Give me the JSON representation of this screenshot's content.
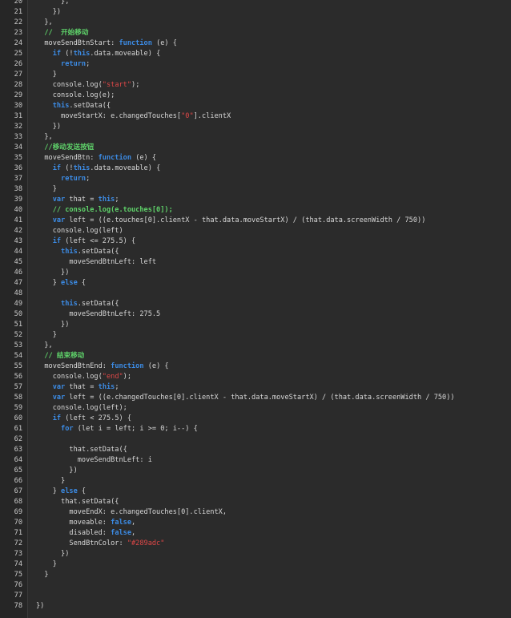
{
  "editor": {
    "lines": [
      {
        "n": "20",
        "tokens": [
          {
            "t": "      },",
            "c": "plain"
          }
        ]
      },
      {
        "n": "21",
        "tokens": [
          {
            "t": "    })",
            "c": "plain"
          }
        ]
      },
      {
        "n": "22",
        "tokens": [
          {
            "t": "  },",
            "c": "plain"
          }
        ]
      },
      {
        "n": "23",
        "tokens": [
          {
            "t": "  ",
            "c": "plain"
          },
          {
            "t": "//  开始移动",
            "c": "com"
          }
        ]
      },
      {
        "n": "24",
        "tokens": [
          {
            "t": "  moveSendBtnStart: ",
            "c": "plain"
          },
          {
            "t": "function",
            "c": "kw"
          },
          {
            "t": " (e) {",
            "c": "plain"
          }
        ]
      },
      {
        "n": "25",
        "tokens": [
          {
            "t": "    ",
            "c": "plain"
          },
          {
            "t": "if",
            "c": "kw"
          },
          {
            "t": " (!",
            "c": "plain"
          },
          {
            "t": "this",
            "c": "kw"
          },
          {
            "t": ".data.moveable) {",
            "c": "plain"
          }
        ]
      },
      {
        "n": "26",
        "tokens": [
          {
            "t": "      ",
            "c": "plain"
          },
          {
            "t": "return",
            "c": "kw"
          },
          {
            "t": ";",
            "c": "plain"
          }
        ]
      },
      {
        "n": "27",
        "tokens": [
          {
            "t": "    }",
            "c": "plain"
          }
        ]
      },
      {
        "n": "28",
        "tokens": [
          {
            "t": "    console.log(",
            "c": "plain"
          },
          {
            "t": "\"start\"",
            "c": "str"
          },
          {
            "t": ");",
            "c": "plain"
          }
        ]
      },
      {
        "n": "29",
        "tokens": [
          {
            "t": "    console.log(e);",
            "c": "plain"
          }
        ]
      },
      {
        "n": "30",
        "tokens": [
          {
            "t": "    ",
            "c": "plain"
          },
          {
            "t": "this",
            "c": "kw"
          },
          {
            "t": ".setData({",
            "c": "plain"
          }
        ]
      },
      {
        "n": "31",
        "tokens": [
          {
            "t": "      moveStartX: e.changedTouches[",
            "c": "plain"
          },
          {
            "t": "\"0\"",
            "c": "str"
          },
          {
            "t": "].clientX",
            "c": "plain"
          }
        ]
      },
      {
        "n": "32",
        "tokens": [
          {
            "t": "    })",
            "c": "plain"
          }
        ]
      },
      {
        "n": "33",
        "tokens": [
          {
            "t": "  },",
            "c": "plain"
          }
        ]
      },
      {
        "n": "34",
        "tokens": [
          {
            "t": "  ",
            "c": "plain"
          },
          {
            "t": "//移动发送按钮",
            "c": "com"
          }
        ]
      },
      {
        "n": "35",
        "tokens": [
          {
            "t": "  moveSendBtn: ",
            "c": "plain"
          },
          {
            "t": "function",
            "c": "kw"
          },
          {
            "t": " (e) {",
            "c": "plain"
          }
        ]
      },
      {
        "n": "36",
        "tokens": [
          {
            "t": "    ",
            "c": "plain"
          },
          {
            "t": "if",
            "c": "kw"
          },
          {
            "t": " (!",
            "c": "plain"
          },
          {
            "t": "this",
            "c": "kw"
          },
          {
            "t": ".data.moveable) {",
            "c": "plain"
          }
        ]
      },
      {
        "n": "37",
        "tokens": [
          {
            "t": "      ",
            "c": "plain"
          },
          {
            "t": "return",
            "c": "kw"
          },
          {
            "t": ";",
            "c": "plain"
          }
        ]
      },
      {
        "n": "38",
        "tokens": [
          {
            "t": "    }",
            "c": "plain"
          }
        ]
      },
      {
        "n": "39",
        "tokens": [
          {
            "t": "    ",
            "c": "plain"
          },
          {
            "t": "var",
            "c": "kw"
          },
          {
            "t": " that = ",
            "c": "plain"
          },
          {
            "t": "this",
            "c": "kw"
          },
          {
            "t": ";",
            "c": "plain"
          }
        ]
      },
      {
        "n": "40",
        "tokens": [
          {
            "t": "    ",
            "c": "plain"
          },
          {
            "t": "// console.log(e.touches[0]);",
            "c": "com"
          }
        ]
      },
      {
        "n": "41",
        "tokens": [
          {
            "t": "    ",
            "c": "plain"
          },
          {
            "t": "var",
            "c": "kw"
          },
          {
            "t": " left = ((e.touches[0].clientX - that.data.moveStartX) / (that.data.screenWidth / 750))",
            "c": "plain"
          }
        ]
      },
      {
        "n": "42",
        "tokens": [
          {
            "t": "    console.log(left)",
            "c": "plain"
          }
        ]
      },
      {
        "n": "43",
        "tokens": [
          {
            "t": "    ",
            "c": "plain"
          },
          {
            "t": "if",
            "c": "kw"
          },
          {
            "t": " (left <= 275.5) {",
            "c": "plain"
          }
        ]
      },
      {
        "n": "44",
        "tokens": [
          {
            "t": "      ",
            "c": "plain"
          },
          {
            "t": "this",
            "c": "kw"
          },
          {
            "t": ".setData({",
            "c": "plain"
          }
        ]
      },
      {
        "n": "45",
        "tokens": [
          {
            "t": "        moveSendBtnLeft: left",
            "c": "plain"
          }
        ]
      },
      {
        "n": "46",
        "tokens": [
          {
            "t": "      })",
            "c": "plain"
          }
        ]
      },
      {
        "n": "47",
        "tokens": [
          {
            "t": "    } ",
            "c": "plain"
          },
          {
            "t": "else",
            "c": "kw"
          },
          {
            "t": " {",
            "c": "plain"
          }
        ]
      },
      {
        "n": "48",
        "tokens": [
          {
            "t": "",
            "c": "plain"
          }
        ]
      },
      {
        "n": "49",
        "tokens": [
          {
            "t": "      ",
            "c": "plain"
          },
          {
            "t": "this",
            "c": "kw"
          },
          {
            "t": ".setData({",
            "c": "plain"
          }
        ]
      },
      {
        "n": "50",
        "tokens": [
          {
            "t": "        moveSendBtnLeft: 275.5",
            "c": "plain"
          }
        ]
      },
      {
        "n": "51",
        "tokens": [
          {
            "t": "      })",
            "c": "plain"
          }
        ]
      },
      {
        "n": "52",
        "tokens": [
          {
            "t": "    }",
            "c": "plain"
          }
        ]
      },
      {
        "n": "53",
        "tokens": [
          {
            "t": "  },",
            "c": "plain"
          }
        ]
      },
      {
        "n": "54",
        "tokens": [
          {
            "t": "  ",
            "c": "plain"
          },
          {
            "t": "// 结束移动",
            "c": "com"
          }
        ]
      },
      {
        "n": "55",
        "tokens": [
          {
            "t": "  moveSendBtnEnd: ",
            "c": "plain"
          },
          {
            "t": "function",
            "c": "kw"
          },
          {
            "t": " (e) {",
            "c": "plain"
          }
        ]
      },
      {
        "n": "56",
        "tokens": [
          {
            "t": "    console.log(",
            "c": "plain"
          },
          {
            "t": "\"end\"",
            "c": "str"
          },
          {
            "t": ");",
            "c": "plain"
          }
        ]
      },
      {
        "n": "57",
        "tokens": [
          {
            "t": "    ",
            "c": "plain"
          },
          {
            "t": "var",
            "c": "kw"
          },
          {
            "t": " that = ",
            "c": "plain"
          },
          {
            "t": "this",
            "c": "kw"
          },
          {
            "t": ";",
            "c": "plain"
          }
        ]
      },
      {
        "n": "58",
        "tokens": [
          {
            "t": "    ",
            "c": "plain"
          },
          {
            "t": "var",
            "c": "kw"
          },
          {
            "t": " left = ((e.changedTouches[0].clientX - that.data.moveStartX) / (that.data.screenWidth / 750))",
            "c": "plain"
          }
        ]
      },
      {
        "n": "59",
        "tokens": [
          {
            "t": "    console.log(left);",
            "c": "plain"
          }
        ]
      },
      {
        "n": "60",
        "tokens": [
          {
            "t": "    ",
            "c": "plain"
          },
          {
            "t": "if",
            "c": "kw"
          },
          {
            "t": " (left < 275.5) {",
            "c": "plain"
          }
        ]
      },
      {
        "n": "61",
        "tokens": [
          {
            "t": "      ",
            "c": "plain"
          },
          {
            "t": "for",
            "c": "kw"
          },
          {
            "t": " (let i = left; i >= 0; i--) {",
            "c": "plain"
          }
        ]
      },
      {
        "n": "62",
        "tokens": [
          {
            "t": "",
            "c": "plain"
          }
        ]
      },
      {
        "n": "63",
        "tokens": [
          {
            "t": "        that.setData({",
            "c": "plain"
          }
        ]
      },
      {
        "n": "64",
        "tokens": [
          {
            "t": "          moveSendBtnLeft: i",
            "c": "plain"
          }
        ]
      },
      {
        "n": "65",
        "tokens": [
          {
            "t": "        })",
            "c": "plain"
          }
        ]
      },
      {
        "n": "66",
        "tokens": [
          {
            "t": "      }",
            "c": "plain"
          }
        ]
      },
      {
        "n": "67",
        "tokens": [
          {
            "t": "    } ",
            "c": "plain"
          },
          {
            "t": "else",
            "c": "kw"
          },
          {
            "t": " {",
            "c": "plain"
          }
        ]
      },
      {
        "n": "68",
        "tokens": [
          {
            "t": "      that.setData({",
            "c": "plain"
          }
        ]
      },
      {
        "n": "69",
        "tokens": [
          {
            "t": "        moveEndX: e.changedTouches[0].clientX,",
            "c": "plain"
          }
        ]
      },
      {
        "n": "70",
        "tokens": [
          {
            "t": "        moveable: ",
            "c": "plain"
          },
          {
            "t": "false",
            "c": "kw"
          },
          {
            "t": ",",
            "c": "plain"
          }
        ]
      },
      {
        "n": "71",
        "tokens": [
          {
            "t": "        disabled: ",
            "c": "plain"
          },
          {
            "t": "false",
            "c": "kw"
          },
          {
            "t": ",",
            "c": "plain"
          }
        ]
      },
      {
        "n": "72",
        "tokens": [
          {
            "t": "        SendBtnColor: ",
            "c": "plain"
          },
          {
            "t": "\"#289adc\"",
            "c": "str"
          }
        ]
      },
      {
        "n": "73",
        "tokens": [
          {
            "t": "      })",
            "c": "plain"
          }
        ]
      },
      {
        "n": "74",
        "tokens": [
          {
            "t": "    }",
            "c": "plain"
          }
        ]
      },
      {
        "n": "75",
        "tokens": [
          {
            "t": "  }",
            "c": "plain"
          }
        ]
      },
      {
        "n": "76",
        "tokens": [
          {
            "t": "",
            "c": "plain"
          }
        ]
      },
      {
        "n": "77",
        "tokens": [
          {
            "t": "",
            "c": "plain"
          }
        ]
      },
      {
        "n": "78",
        "tokens": [
          {
            "t": "})",
            "c": "plain"
          }
        ]
      }
    ]
  },
  "colors": {
    "background": "#2b2b2b",
    "gutter": "#262626",
    "keyword": "#3c8ce6",
    "string": "#e04848",
    "comment": "#5fd36a",
    "text": "#d8d8d8"
  }
}
